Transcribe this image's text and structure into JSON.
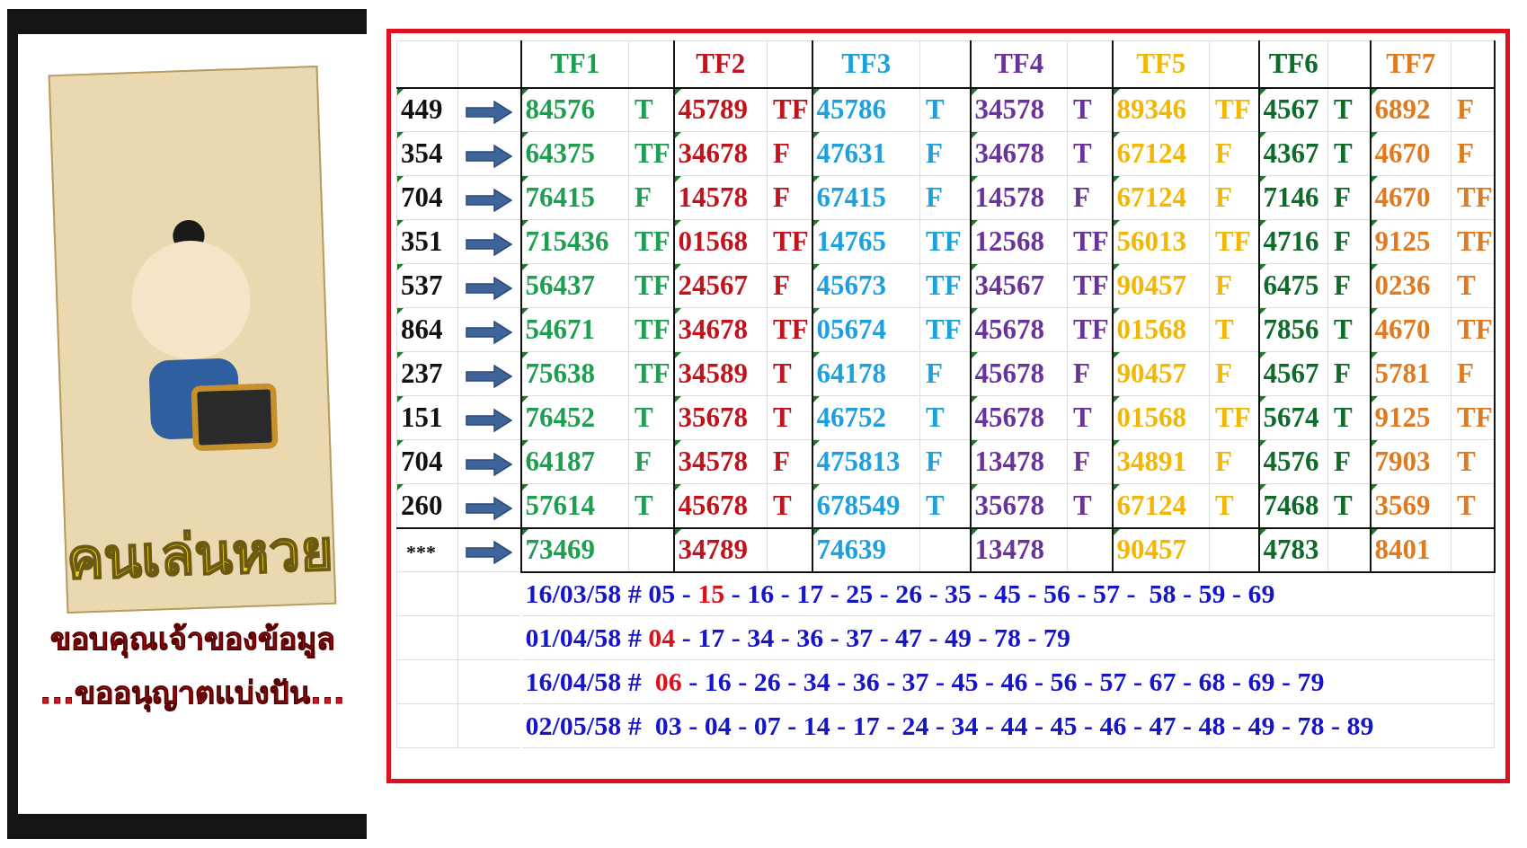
{
  "poster": {
    "title": "คนเล่นหวย",
    "thanks": "ขอบคุณเจ้าของข้อมูล",
    "permission": "...ขออนุญาตแบ่งปัน..."
  },
  "columns": [
    {
      "label": "TF1",
      "color": "#1e9e50"
    },
    {
      "label": "TF2",
      "color": "#c0141c"
    },
    {
      "label": "TF3",
      "color": "#1ea0dc"
    },
    {
      "label": "TF4",
      "color": "#6a3399"
    },
    {
      "label": "TF5",
      "color": "#f2b705"
    },
    {
      "label": "TF6",
      "color": "#0f6b2a"
    },
    {
      "label": "TF7",
      "color": "#e07a20"
    }
  ],
  "rows": [
    {
      "label": "449",
      "cells": [
        {
          "number": "84576",
          "result": "T"
        },
        {
          "number": "45789",
          "result": "TF"
        },
        {
          "number": "45786",
          "result": "T"
        },
        {
          "number": "34578",
          "result": "T"
        },
        {
          "number": "89346",
          "result": "TF"
        },
        {
          "number": "4567",
          "result": "T"
        },
        {
          "number": "6892",
          "result": "F"
        }
      ]
    },
    {
      "label": "354",
      "cells": [
        {
          "number": "64375",
          "result": "TF"
        },
        {
          "number": "34678",
          "result": "F"
        },
        {
          "number": "47631",
          "result": "F"
        },
        {
          "number": "34678",
          "result": "T"
        },
        {
          "number": "67124",
          "result": "F"
        },
        {
          "number": "4367",
          "result": "T"
        },
        {
          "number": "4670",
          "result": "F"
        }
      ]
    },
    {
      "label": "704",
      "cells": [
        {
          "number": "76415",
          "result": "F"
        },
        {
          "number": "14578",
          "result": "F"
        },
        {
          "number": "67415",
          "result": "F"
        },
        {
          "number": "14578",
          "result": "F"
        },
        {
          "number": "67124",
          "result": "F"
        },
        {
          "number": "7146",
          "result": "F"
        },
        {
          "number": "4670",
          "result": "TF"
        }
      ]
    },
    {
      "label": "351",
      "cells": [
        {
          "number": "715436",
          "result": "TF"
        },
        {
          "number": "01568",
          "result": "TF"
        },
        {
          "number": "14765",
          "result": "TF"
        },
        {
          "number": "12568",
          "result": "TF"
        },
        {
          "number": "56013",
          "result": "TF"
        },
        {
          "number": "4716",
          "result": "F"
        },
        {
          "number": "9125",
          "result": "TF"
        }
      ]
    },
    {
      "label": "537",
      "cells": [
        {
          "number": "56437",
          "result": "TF"
        },
        {
          "number": "24567",
          "result": "F"
        },
        {
          "number": "45673",
          "result": "TF"
        },
        {
          "number": "34567",
          "result": "TF"
        },
        {
          "number": "90457",
          "result": "F"
        },
        {
          "number": "6475",
          "result": "F"
        },
        {
          "number": "0236",
          "result": "T"
        }
      ]
    },
    {
      "label": "864",
      "cells": [
        {
          "number": "54671",
          "result": "TF"
        },
        {
          "number": "34678",
          "result": "TF"
        },
        {
          "number": "05674",
          "result": "TF"
        },
        {
          "number": "45678",
          "result": "TF"
        },
        {
          "number": "01568",
          "result": "T"
        },
        {
          "number": "7856",
          "result": "T"
        },
        {
          "number": "4670",
          "result": "TF"
        }
      ]
    },
    {
      "label": "237",
      "cells": [
        {
          "number": "75638",
          "result": "TF"
        },
        {
          "number": "34589",
          "result": "T"
        },
        {
          "number": "64178",
          "result": "F"
        },
        {
          "number": "45678",
          "result": "F"
        },
        {
          "number": "90457",
          "result": "F"
        },
        {
          "number": "4567",
          "result": "F"
        },
        {
          "number": "5781",
          "result": "F"
        }
      ]
    },
    {
      "label": "151",
      "cells": [
        {
          "number": "76452",
          "result": "T"
        },
        {
          "number": "35678",
          "result": "T"
        },
        {
          "number": "46752",
          "result": "T"
        },
        {
          "number": "45678",
          "result": "T"
        },
        {
          "number": "01568",
          "result": "TF"
        },
        {
          "number": "5674",
          "result": "T"
        },
        {
          "number": "9125",
          "result": "TF"
        }
      ]
    },
    {
      "label": "704",
      "cells": [
        {
          "number": "64187",
          "result": "F"
        },
        {
          "number": "34578",
          "result": "F"
        },
        {
          "number": "475813",
          "result": "F"
        },
        {
          "number": "13478",
          "result": "F"
        },
        {
          "number": "34891",
          "result": "F"
        },
        {
          "number": "4576",
          "result": "F"
        },
        {
          "number": "7903",
          "result": "T"
        }
      ]
    },
    {
      "label": "260",
      "cells": [
        {
          "number": "57614",
          "result": "T"
        },
        {
          "number": "45678",
          "result": "T"
        },
        {
          "number": "678549",
          "result": "T"
        },
        {
          "number": "35678",
          "result": "T"
        },
        {
          "number": "67124",
          "result": "T"
        },
        {
          "number": "7468",
          "result": "T"
        },
        {
          "number": "3569",
          "result": "T"
        }
      ]
    },
    {
      "label": "***",
      "cells": [
        {
          "number": "73469"
        },
        {
          "number": "34789"
        },
        {
          "number": "74639"
        },
        {
          "number": "13478"
        },
        {
          "number": "90457"
        },
        {
          "number": "4783"
        },
        {
          "number": "8401"
        }
      ]
    }
  ],
  "history": [
    {
      "segments": [
        {
          "text": "16/03/58 # 05 - ",
          "highlighted": false
        },
        {
          "text": "15",
          "highlighted": true
        },
        {
          "text": " - 16 - 17 - 25 - 26 - 35 - 45 - 56 - 57 -  58 - 59 - 69",
          "highlighted": false
        }
      ]
    },
    {
      "segments": [
        {
          "text": "01/04/58 # ",
          "highlighted": false
        },
        {
          "text": "04",
          "highlighted": true
        },
        {
          "text": " - 17 - 34 - 36 - 37 - 47 - 49 - 78 - 79",
          "highlighted": false
        }
      ]
    },
    {
      "segments": [
        {
          "text": "16/04/58 #  ",
          "highlighted": false
        },
        {
          "text": "06",
          "highlighted": true
        },
        {
          "text": " - 16 - 26 - 34 - 36 - 37 - 45 - 46 - 56 - 57 - 67 - 68 - 69 - 79",
          "highlighted": false
        }
      ]
    },
    {
      "segments": [
        {
          "text": "02/05/58 #  03 - 04 - 07 - 14 - 17 - 24 - 34 - 44 - 45 - 46 - 47 - 48 - 49 - 78 - 89",
          "highlighted": false
        }
      ]
    }
  ]
}
